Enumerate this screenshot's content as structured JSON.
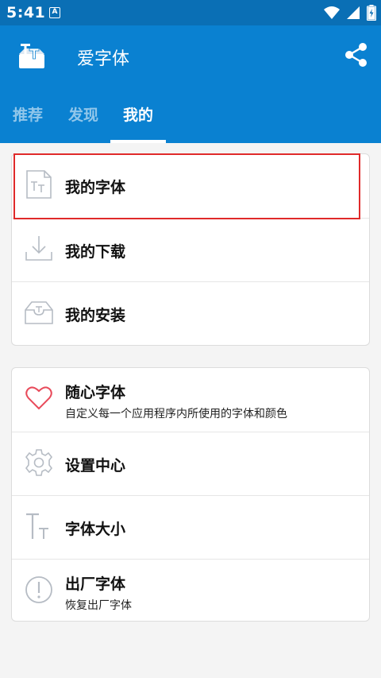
{
  "status": {
    "time": "5:41",
    "notif_letter": "A"
  },
  "appbar": {
    "title": "爱字体"
  },
  "tabs": [
    {
      "label": "推荐"
    },
    {
      "label": "发现"
    },
    {
      "label": "我的"
    }
  ],
  "my_section": [
    {
      "label": "我的字体",
      "icon": "font-file-icon"
    },
    {
      "label": "我的下载",
      "icon": "download-icon"
    },
    {
      "label": "我的安装",
      "icon": "install-tray-icon"
    }
  ],
  "more_section": [
    {
      "label": "随心字体",
      "sub": "自定义每一个应用程序内所使用的字体和颜色",
      "icon": "heart-icon"
    },
    {
      "label": "设置中心",
      "icon": "gear-icon"
    },
    {
      "label": "字体大小",
      "icon": "font-size-icon"
    },
    {
      "label": "出厂字体",
      "sub": "恢复出厂字体",
      "icon": "alert-circle-icon"
    }
  ],
  "colors": {
    "primary": "#0a81d1",
    "statusbar": "#0a6fb5",
    "highlight": "#e02a2a",
    "heart": "#e84a5a"
  }
}
